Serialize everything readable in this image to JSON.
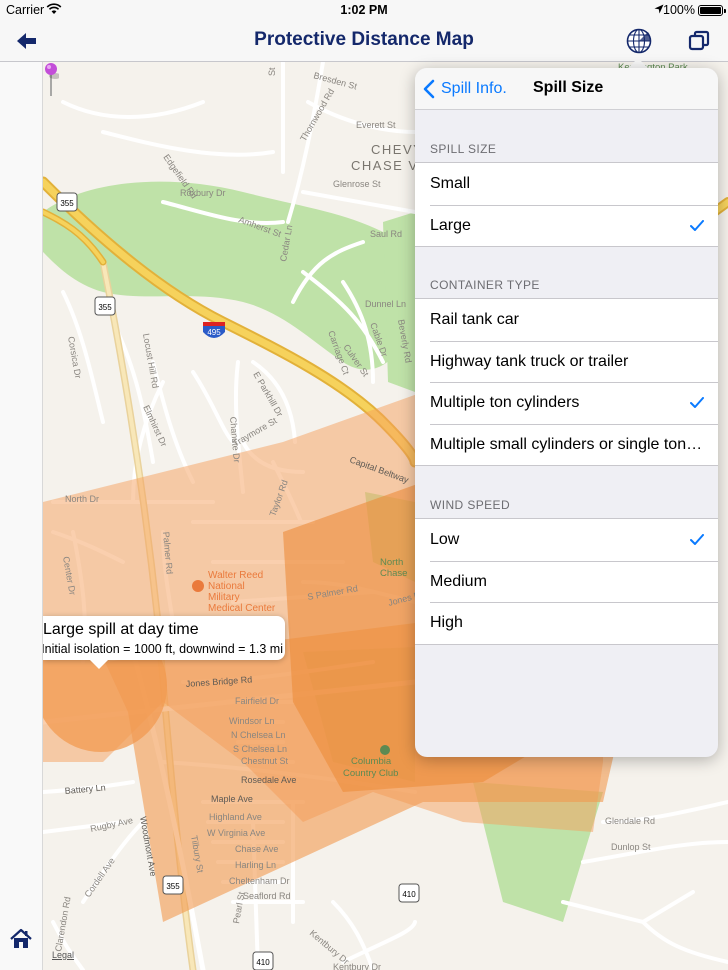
{
  "status_bar": {
    "carrier": "Carrier",
    "time": "1:02 PM",
    "battery_text": "100%",
    "battery_level": 1.0
  },
  "nav": {
    "title": "Protective Distance Map",
    "back_icon": "left-arrow-icon",
    "radar_icon": "radar-globe-icon",
    "copy_icon": "copy-windows-icon",
    "title_color": "#14286b"
  },
  "sidebar": {
    "home_icon": "home-icon"
  },
  "map": {
    "callout": {
      "title": "Large spill at day time",
      "subtitle": "Initial isolation = 1000 ft, downwind = 1.3 mi"
    },
    "legal": "Legal",
    "streets": [
      "Edgefield Rd",
      "Roxbury Dr",
      "Thornwood Rd",
      "Amherst St",
      "Cedar Ln",
      "Everett St",
      "Glenrose St",
      "Saul Rd",
      "Dunnel Ln",
      "Carriage Ct",
      "Culver St",
      "Cable Dr",
      "Beverly Rd",
      "Locust Hill Rd",
      "Corsica Dr",
      "Elmhirst Dr",
      "Chanute Dr",
      "Traymore St",
      "E Parkhill Dr",
      "Taylor Rd",
      "North Dr",
      "Center Dr",
      "Palmer Rd",
      "S Palmer Rd",
      "Jones Bridge Rd",
      "Fairfield Dr",
      "Windsor Ln",
      "N Chelsea Ln",
      "S Chelsea Ln",
      "Chestnut St",
      "Rosedale Ave",
      "Maple Ave",
      "Highland Ave",
      "W Virginia Ave",
      "Chase Ave",
      "Harling Ln",
      "Cheltenham Dr",
      "Seaflord Rd",
      "Battery Ln",
      "Rugby Ave",
      "Cordell Ave",
      "Woodmont Ave",
      "Tilbury St",
      "Pearl St",
      "Kentbury Dr",
      "Glendale Rd",
      "Dunlop St",
      "Capital Beltway",
      "Jones Mill Rd",
      "Clarendon Rd",
      "Bresden St",
      "Kensington Park"
    ],
    "pois": [
      "Walter Reed National Military Medical Center",
      "Columbia Country Club"
    ],
    "areas": [
      "CHEVY CHASE VIEW",
      "North Chevy Chase"
    ],
    "shields": [
      "355",
      "355",
      "495",
      "355",
      "410",
      "410"
    ],
    "colors": {
      "zone_light": "#f6a86a",
      "zone_dark": "#ee8c3c",
      "park": "#bfe2a8",
      "highway": "#f4c74a",
      "road": "#ffffff",
      "land": "#f5f2ec"
    }
  },
  "popover": {
    "back_label": "Spill Info.",
    "title": "Spill Size",
    "sections": [
      {
        "header": "SPILL SIZE",
        "items": [
          {
            "label": "Small",
            "checked": false
          },
          {
            "label": "Large",
            "checked": true
          }
        ]
      },
      {
        "header": "CONTAINER TYPE",
        "items": [
          {
            "label": "Rail tank car",
            "checked": false
          },
          {
            "label": "Highway tank truck or trailer",
            "checked": false
          },
          {
            "label": "Multiple ton cylinders",
            "checked": true
          },
          {
            "label": "Multiple small cylinders or single ton cylinder",
            "checked": false
          }
        ]
      },
      {
        "header": "WIND SPEED",
        "items": [
          {
            "label": "Low",
            "checked": true
          },
          {
            "label": "Medium",
            "checked": false
          },
          {
            "label": "High",
            "checked": false
          }
        ]
      }
    ],
    "accent": "#0a7aff"
  }
}
